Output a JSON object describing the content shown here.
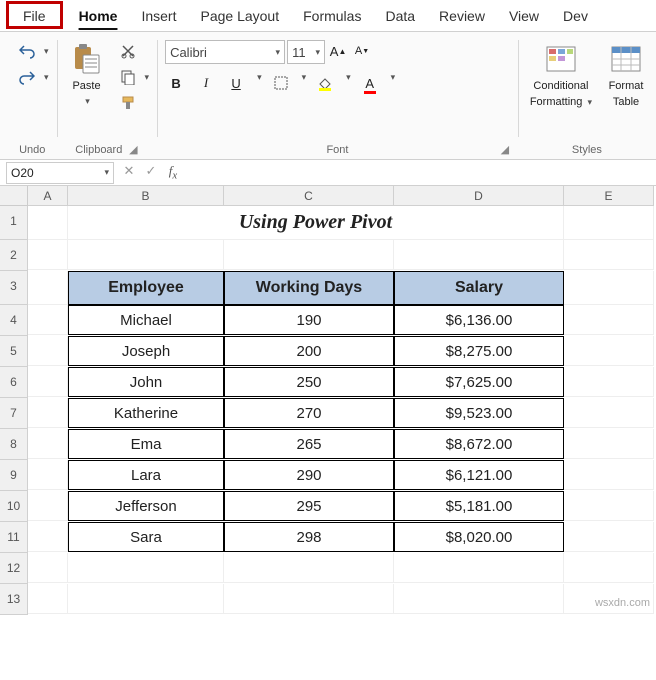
{
  "tabs": {
    "file": "File",
    "home": "Home",
    "insert": "Insert",
    "page_layout": "Page Layout",
    "formulas": "Formulas",
    "data": "Data",
    "review": "Review",
    "view": "View",
    "dev": "Dev"
  },
  "groups": {
    "undo": "Undo",
    "clipboard": "Clipboard",
    "font": "Font",
    "styles": "Styles"
  },
  "clipboard": {
    "paste": "Paste"
  },
  "font": {
    "name": "Calibri",
    "size": "11"
  },
  "styles": {
    "cond_fmt_1": "Conditional",
    "cond_fmt_2": "Formatting",
    "fmt_table_1": "Format",
    "fmt_table_2": "Table"
  },
  "namebox": "O20",
  "columns": [
    "A",
    "B",
    "C",
    "D",
    "E"
  ],
  "rows": [
    "1",
    "2",
    "3",
    "4",
    "5",
    "6",
    "7",
    "8",
    "9",
    "10",
    "11",
    "12",
    "13"
  ],
  "title": "Using Power Pivot",
  "table": {
    "headers": [
      "Employee",
      "Working Days",
      "Salary"
    ],
    "data": [
      [
        "Michael",
        "190",
        "$6,136.00"
      ],
      [
        "Joseph",
        "200",
        "$8,275.00"
      ],
      [
        "John",
        "250",
        "$7,625.00"
      ],
      [
        "Katherine",
        "270",
        "$9,523.00"
      ],
      [
        "Ema",
        "265",
        "$8,672.00"
      ],
      [
        "Lara",
        "290",
        "$6,121.00"
      ],
      [
        "Jefferson",
        "295",
        "$5,181.00"
      ],
      [
        "Sara",
        "298",
        "$8,020.00"
      ]
    ]
  },
  "watermark": "wsxdn.com"
}
